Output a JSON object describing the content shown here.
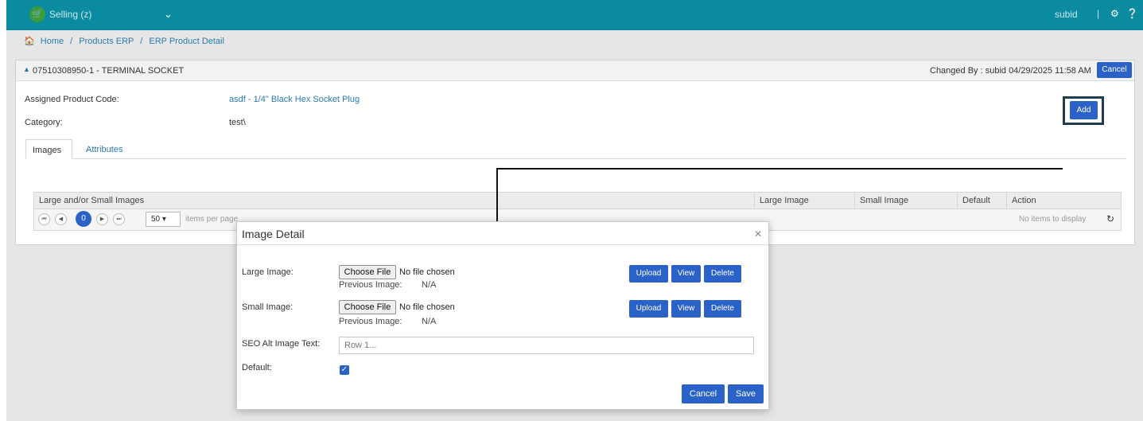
{
  "topbar": {
    "app_label": "Selling (z)",
    "user": "subid",
    "separator": "|"
  },
  "breadcrumb": {
    "items": [
      "Home",
      "Products ERP",
      "ERP Product Detail"
    ],
    "separator": "/"
  },
  "panel": {
    "title": "07510308950-1 - TERMINAL SOCKET",
    "changed_by": "Changed By : subid 04/29/2025 11:58 AM",
    "cancel_label": "Cancel",
    "assigned_label": "Assigned Product Code:",
    "assigned_value": "asdf - 1/4\" Black Hex Socket Plug",
    "category_label": "Category:",
    "category_value": "test\\",
    "tabs": [
      {
        "label": "Images",
        "active": true
      },
      {
        "label": "Attributes",
        "active": false
      }
    ],
    "add_label": "Add"
  },
  "grid": {
    "columns": [
      "Large and/or Small Images",
      "Large Image",
      "Small Image",
      "Default",
      "Action"
    ],
    "current_page": "0",
    "page_size": "50",
    "items_per_page": "items per page",
    "no_items": "No items to display"
  },
  "modal": {
    "title": "Image Detail",
    "large_label": "Large Image:",
    "small_label": "Small Image:",
    "choose_file": "Choose File",
    "no_file": "No file chosen",
    "previous_label": "Previous Image:",
    "previous_value": "N/A",
    "upload": "Upload",
    "view": "View",
    "delete": "Delete",
    "seo_label": "SEO Alt Image Text:",
    "seo_placeholder": "Row 1...",
    "default_label": "Default:",
    "default_checked": true,
    "cancel": "Cancel",
    "save": "Save"
  },
  "colors": {
    "topbar": "#0a8ba0",
    "primary_button": "#2b62c8",
    "link": "#2a7ab0"
  }
}
